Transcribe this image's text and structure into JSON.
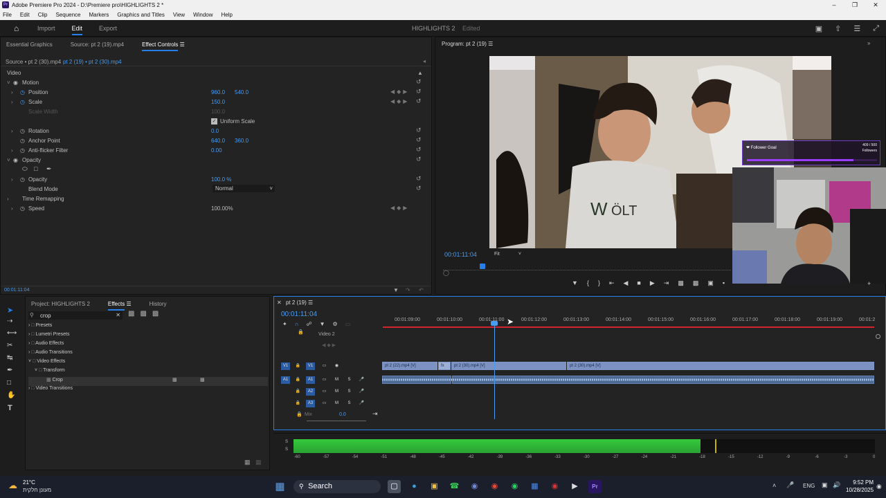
{
  "titlebar": {
    "title": "Adobe Premiere Pro 2024 - D:\\Premiere pro\\HIGHLIGHTS 2 *",
    "app_icon": "Pr"
  },
  "menu": [
    "File",
    "Edit",
    "Clip",
    "Sequence",
    "Markers",
    "Graphics and Titles",
    "View",
    "Window",
    "Help"
  ],
  "header": {
    "tabs": [
      "Import",
      "Edit",
      "Export"
    ],
    "active_tab": "Edit",
    "project_name": "HIGHLIGHTS 2",
    "project_status": "Edited"
  },
  "effect_panel": {
    "tabs": [
      "Essential Graphics",
      "Source: pt 2 (19).mp4",
      "Effect Controls"
    ],
    "source_label": "Source • pt 2 (30).mp4",
    "clip_label": "pt 2 (19) • pt 2 (30).mp4",
    "section_video": "Video",
    "motion": "Motion",
    "position_label": "Position",
    "position_x": "960.0",
    "position_y": "540.0",
    "scale_label": "Scale",
    "scale": "150.0",
    "scale_width_label": "Scale Width",
    "scale_width": "100.0",
    "uniform_scale": "Uniform Scale",
    "rotation_label": "Rotation",
    "rotation": "0.0",
    "anchor_label": "Anchor Point",
    "anchor_x": "640.0",
    "anchor_y": "360.0",
    "antiflicker_label": "Anti-flicker Filter",
    "antiflicker": "0.00",
    "opacity_section": "Opacity",
    "opacity_label": "Opacity",
    "opacity": "100.0 %",
    "blend_label": "Blend Mode",
    "blend": "Normal",
    "time_remap": "Time Remapping",
    "speed_label": "Speed",
    "speed": "100.00%",
    "timecode": "00:01:11:04"
  },
  "program": {
    "title": "Program: pt 2 (19)",
    "timecode": "00:01:11:04",
    "fit": "Fit",
    "follower_goal": "Follower Goal",
    "follower_count": "409 / 500",
    "followers_word": "Followers"
  },
  "project_panel": {
    "tabs": [
      "Project: HIGHLIGHTS 2",
      "Effects",
      "History"
    ],
    "search": "crop",
    "tree": [
      "Presets",
      "Lumetri Presets",
      "Audio Effects",
      "Audio Transitions",
      "Video Effects",
      "Transform",
      "Crop",
      "Video Transitions"
    ]
  },
  "timeline": {
    "tab": "pt 2 (19)",
    "timecode": "00:01:11:04",
    "ruler": [
      "00:01:09:00",
      "00:01:10:00",
      "00:01:11:00",
      "00:01:12:00",
      "00:01:13:00",
      "00:01:14:00",
      "00:01:15:00",
      "00:01:16:00",
      "00:01:17:00",
      "00:01:18:00",
      "00:01:19:00",
      "00:01:2"
    ],
    "tracks": {
      "v2": "Video 2",
      "v1": "V1",
      "a1": "A1",
      "a2": "A2",
      "a3": "A3",
      "mix": "Mix",
      "mix_val": "0.0"
    },
    "clips": [
      "pt 2 (22).mp4 [V]",
      "fx",
      "pt 2 (30).mp4 [V]",
      "pt 2 (30).mp4 [V]"
    ]
  },
  "audio_meter": {
    "labels": [
      "-60",
      "-57",
      "-54",
      "-51",
      "-48",
      "-45",
      "-42",
      "-39",
      "-36",
      "-33",
      "-30",
      "-27",
      "-24",
      "-21",
      "-18",
      "-15",
      "-12",
      "-9",
      "-6",
      "-3",
      "0"
    ],
    "s_label": "S",
    "level_percent": 70
  },
  "taskbar": {
    "temp": "21°C",
    "weather": "מעונן חלקית",
    "search": "Search",
    "lang": "ENG",
    "time": "9:52 PM",
    "date": "10/28/2025"
  },
  "colors": {
    "accent": "#2680eb",
    "value_blue": "#4a9cf0",
    "clip_video": "#7b92c3",
    "meter_green": "#34c93c"
  }
}
